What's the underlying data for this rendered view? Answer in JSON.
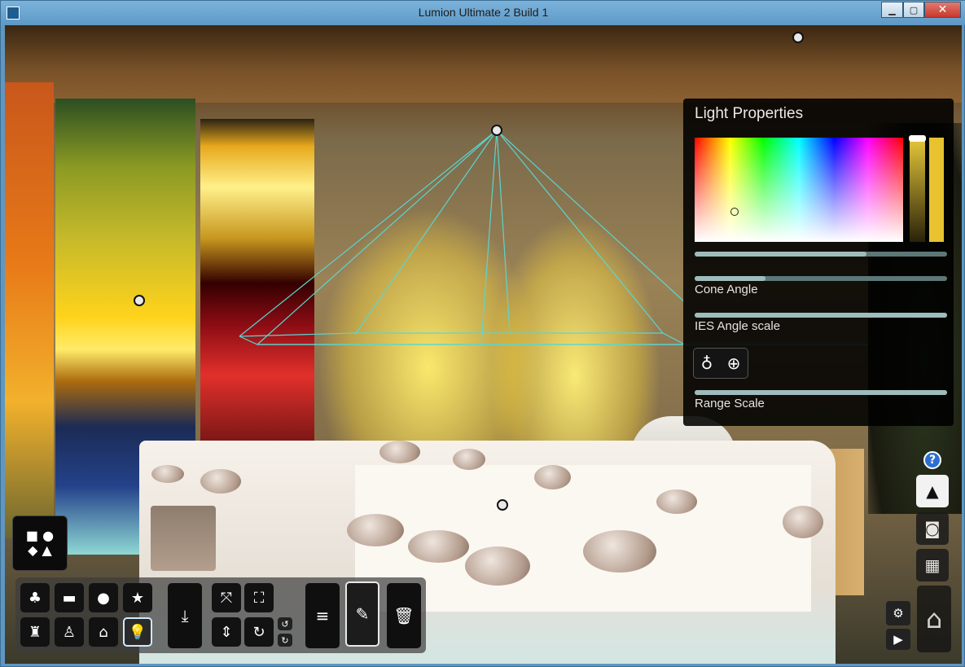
{
  "window": {
    "title": "Lumion Ultimate 2 Build 1",
    "minimize_icon": "minimize-icon",
    "maximize_icon": "maximize-icon",
    "close_icon": "close-icon"
  },
  "light_properties": {
    "title": "Light Properties",
    "selected_color": "#e8c32f",
    "brightness_level": 0.97,
    "color_slider_fill": 0.68,
    "cone_angle": {
      "label": "Cone Angle",
      "fill": 0.28
    },
    "ies_angle_scale": {
      "label": "IES Angle scale",
      "fill": 1.0
    },
    "range_scale": {
      "label": "Range Scale",
      "fill": 1.0
    },
    "icons": [
      "light-bulb-icon",
      "crosshair-icon"
    ]
  },
  "toolbar": {
    "categories": [
      {
        "name": "tree-icon",
        "glyph": "♣"
      },
      {
        "name": "car-icon",
        "glyph": "▬"
      },
      {
        "name": "rocks-icon",
        "glyph": "●"
      },
      {
        "name": "effects-icon",
        "glyph": "★"
      },
      {
        "name": "chair-icon",
        "glyph": "♜"
      },
      {
        "name": "person-icon",
        "glyph": "♙"
      },
      {
        "name": "house-icon",
        "glyph": "⌂"
      },
      {
        "name": "light-icon",
        "glyph": "💡",
        "active": true
      }
    ],
    "place_icon": "place-object-icon",
    "tools": [
      "move-icon",
      "scale-icon",
      "height-icon",
      "rotate-icon"
    ],
    "menu_icon": "list-icon",
    "edit_icon": "edit-pencil-icon",
    "delete_icon": "trash-icon"
  },
  "right_panel": {
    "help": "?",
    "modes": [
      "landscape-mode-icon",
      "photo-mode-icon",
      "movie-mode-icon"
    ],
    "settings_icon": "gear-icon",
    "play_icon": "play-icon",
    "home_icon": "home-icon"
  },
  "shapes_button_icon": "shapes-icon"
}
